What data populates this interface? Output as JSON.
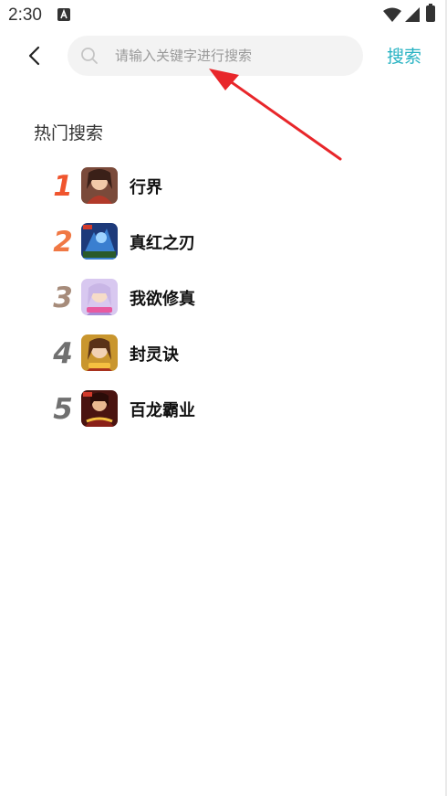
{
  "status_bar": {
    "time": "2:30"
  },
  "header": {
    "back_icon": "chevron-left-icon",
    "search_icon": "search-icon",
    "search_placeholder": "请输入关键字进行搜索",
    "search_value": "",
    "search_button_label": "搜索"
  },
  "hot_search": {
    "title": "热门搜索",
    "items": [
      {
        "rank": "1",
        "name": "行界",
        "rank_color": "#f0552e"
      },
      {
        "rank": "2",
        "name": "真红之刃",
        "rank_color": "#f07844"
      },
      {
        "rank": "3",
        "name": "我欲修真",
        "rank_color": "#a68b7a"
      },
      {
        "rank": "4",
        "name": "封灵诀",
        "rank_color": "#707070"
      },
      {
        "rank": "5",
        "name": "百龙霸业",
        "rank_color": "#707070"
      }
    ]
  },
  "colors": {
    "accent": "#29b3c3",
    "annotation_arrow": "#e8262a"
  }
}
